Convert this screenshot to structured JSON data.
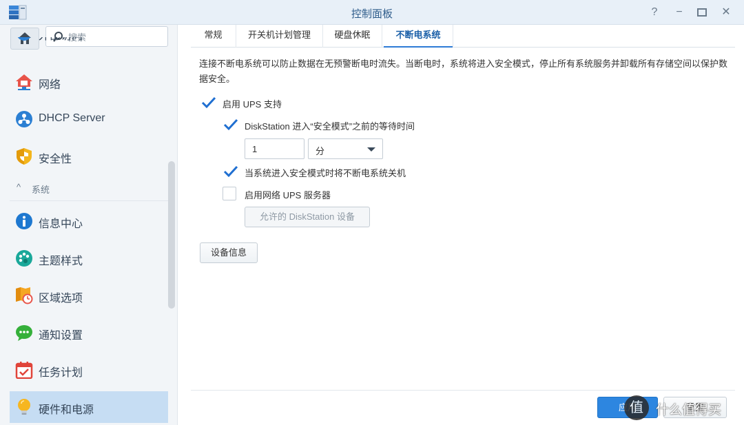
{
  "window": {
    "title": "控制面板",
    "app_icon": "control-panel-icon",
    "controls": {
      "help": "?",
      "minimize": "−",
      "maximize": "▭",
      "close": "✕"
    }
  },
  "sidebar": {
    "search_placeholder": "搜索",
    "partial_top_label": "外部访问",
    "items_before": [
      {
        "label": "网络",
        "icon": "network-house-icon"
      },
      {
        "label": "DHCP Server",
        "icon": "dhcp-server-icon"
      },
      {
        "label": "安全性",
        "icon": "security-shield-icon"
      }
    ],
    "group": {
      "label": "系统",
      "chevron": "^"
    },
    "items_after": [
      {
        "label": "信息中心",
        "icon": "info-icon"
      },
      {
        "label": "主题样式",
        "icon": "theme-palette-icon"
      },
      {
        "label": "区域选项",
        "icon": "regional-options-icon"
      },
      {
        "label": "通知设置",
        "icon": "notification-icon"
      },
      {
        "label": "任务计划",
        "icon": "task-scheduler-icon"
      },
      {
        "label": "硬件和电源",
        "icon": "hardware-power-icon",
        "active": true
      }
    ]
  },
  "tabs": [
    {
      "label": "常规"
    },
    {
      "label": "开关机计划管理"
    },
    {
      "label": "硬盘休眠"
    },
    {
      "label": "不断电系统",
      "active": true
    }
  ],
  "ups": {
    "description": "连接不断电系统可以防止数据在无预警断电时流失。当断电时，系统将进入安全模式，停止所有系统服务并卸载所有存储空间以保护数据安全。",
    "enable_ups": {
      "label": "启用 UPS 支持",
      "checked": true
    },
    "wait_time": {
      "label": "DiskStation 进入“安全模式”之前的等待时间",
      "checked": true
    },
    "wait_value": "1",
    "wait_unit": "分",
    "shutdown_ups": {
      "label": "当系统进入安全模式时将不断电系统关机",
      "checked": true
    },
    "network_ups_server": {
      "label": "启用网络 UPS 服务器",
      "checked": false
    },
    "allowed_devices_button": "允许的 DiskStation 设备",
    "device_info_button": "设备信息"
  },
  "footer": {
    "apply_button": "应用",
    "reset_button": "重置"
  },
  "watermark": {
    "badge": "值",
    "text": "什么值得买"
  },
  "colors": {
    "accent": "#2d86e0",
    "active_tab": "#1a5fa8",
    "sidebar_active": "#c6ddf3",
    "checkmark": "#1f6fd1"
  }
}
